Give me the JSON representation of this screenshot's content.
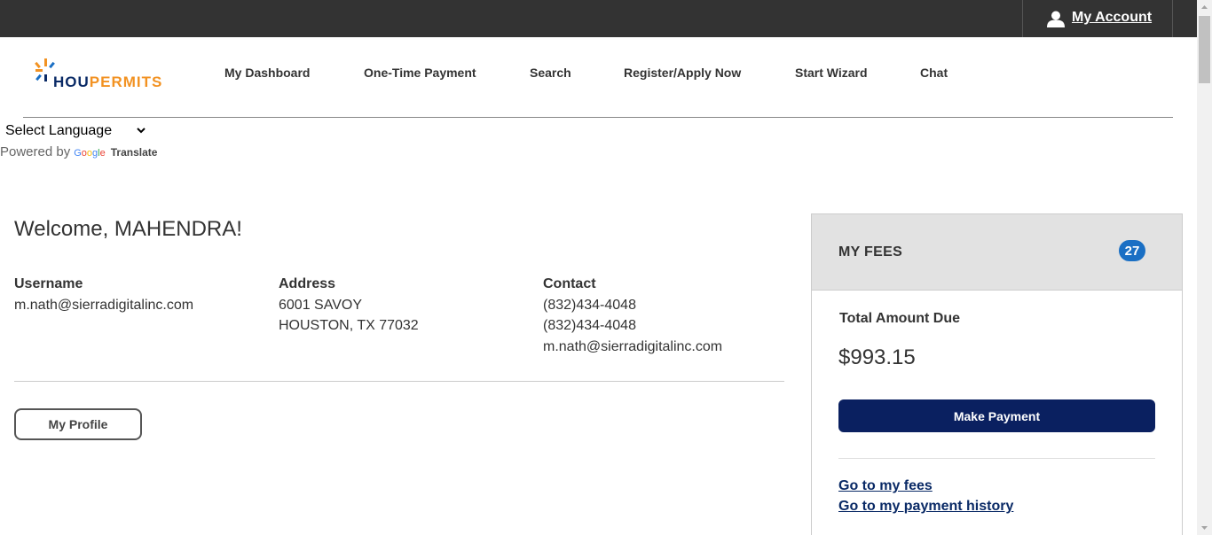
{
  "topbar": {
    "account_label": "My Account"
  },
  "logo": {
    "part1": "HOU",
    "part2": "PERMITS"
  },
  "nav": {
    "items": [
      {
        "label": "My Dashboard"
      },
      {
        "label": "One-Time Payment"
      },
      {
        "label": "Search"
      },
      {
        "label": "Register/Apply Now"
      },
      {
        "label": "Start Wizard"
      },
      {
        "label": "Chat"
      }
    ]
  },
  "translate": {
    "select_label": "Select Language",
    "powered_by": "Powered by",
    "google": "Google",
    "translate": "Translate"
  },
  "welcome": {
    "text": "Welcome, MAHENDRA!"
  },
  "profile": {
    "username": {
      "header": "Username",
      "value": "m.nath@sierradigitalinc.com"
    },
    "address": {
      "header": "Address",
      "line1": "6001 SAVOY",
      "line2": "HOUSTON, TX 77032"
    },
    "contact": {
      "header": "Contact",
      "phone1": "(832)434-4048",
      "phone2": "(832)434-4048",
      "email": "m.nath@sierradigitalinc.com"
    },
    "button_label": "My Profile"
  },
  "fees": {
    "title": "MY FEES",
    "badge_count": "27",
    "due_label": "Total Amount Due",
    "due_amount": "$993.15",
    "pay_button": "Make Payment",
    "link_fees": "Go to my fees",
    "link_history": "Go to my payment history"
  },
  "colors": {
    "topbar_bg": "#333333",
    "brand_navy": "#0a2a66",
    "brand_orange": "#f29222",
    "pay_button_bg": "#0a2060",
    "badge_bg": "#1a6fc4"
  },
  "icons": [
    "user-icon",
    "logo-burst-icon",
    "chevron-down-icon",
    "scroll-up-arrow-icon",
    "scroll-down-arrow-icon"
  ]
}
